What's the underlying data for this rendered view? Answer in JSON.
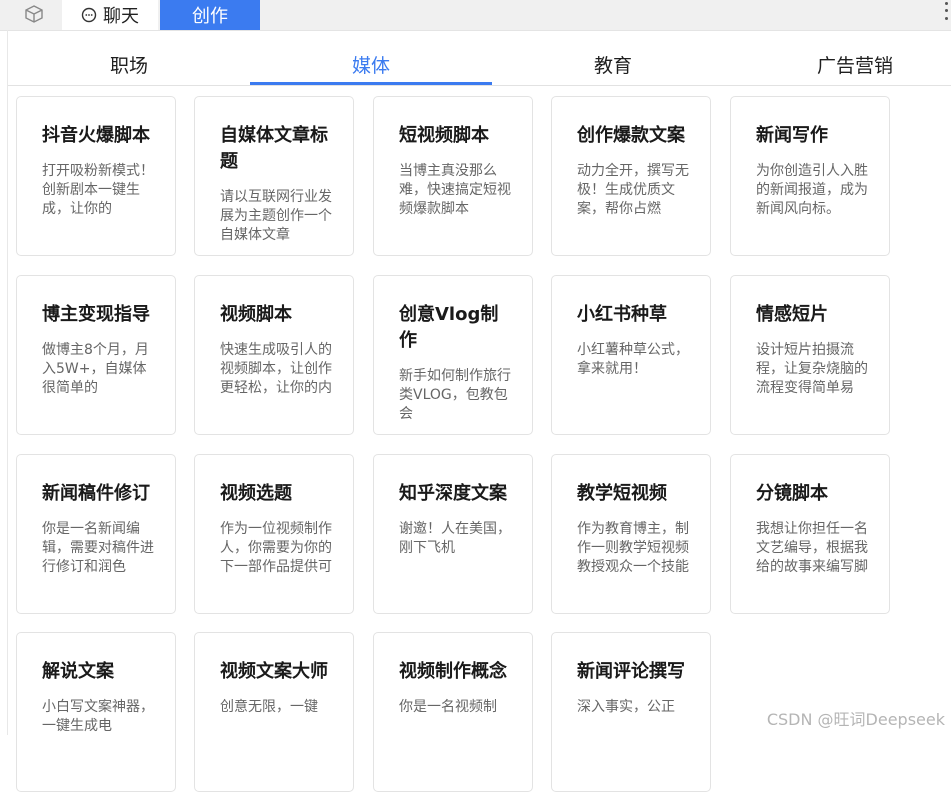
{
  "topbar": {
    "tabs": [
      {
        "label": "聊天",
        "icon": "chat-bubble-icon"
      },
      {
        "label": "创作"
      }
    ],
    "left_icon": "cube-icon",
    "right_icon": "more-vertical-icon",
    "accent_color": "#3b7bf0"
  },
  "categories": [
    "职场",
    "媒体",
    "教育",
    "广告营销"
  ],
  "active_category": "媒体",
  "cards": [
    {
      "title": "抖音火爆脚本",
      "desc": "打开吸粉新模式！创新剧本一键生成，让你的"
    },
    {
      "title": "自媒体文章标题",
      "desc": "请以互联网行业发展为主题创作一个自媒体文章"
    },
    {
      "title": "短视频脚本",
      "desc": "当博主真没那么难，快速搞定短视频爆款脚本"
    },
    {
      "title": "创作爆款文案",
      "desc": "动力全开，撰写无极！生成优质文案，帮你占燃"
    },
    {
      "title": "新闻写作",
      "desc": "为你创造引人入胜的新闻报道，成为新闻风向标。"
    },
    {
      "title": "博主变现指导",
      "desc": "做博主8个月，月入5W+，自媒体很简单的"
    },
    {
      "title": "视频脚本",
      "desc": "快速生成吸引人的视频脚本，让创作更轻松，让你的内容更引人"
    },
    {
      "title": "创意Vlog制作",
      "desc": "新手如何制作旅行类VLOG，包教包会"
    },
    {
      "title": "小红书种草",
      "desc": "小红薯种草公式，拿来就用！"
    },
    {
      "title": "情感短片",
      "desc": "设计短片拍摄流程，让复杂烧脑的流程变得简单易懂。"
    },
    {
      "title": "新闻稿件修订",
      "desc": "你是一名新闻编辑，需要对稿件进行修订和润色"
    },
    {
      "title": "视频选题",
      "desc": "作为一位视频制作人，你需要为你的下一部作品提供可能的选题"
    },
    {
      "title": "知乎深度文案",
      "desc": "谢邀！人在美国，刚下飞机"
    },
    {
      "title": "教学短视频",
      "desc": "作为教育博主，制作一则教学短视频教授观众一个技能或知识点"
    },
    {
      "title": "分镜脚本",
      "desc": "我想让你担任一名文艺编导，根据我给的故事来编写脚本，用标"
    },
    {
      "title": "解说文案",
      "desc": "小白写文案神器，一键生成电"
    },
    {
      "title": "视频文案大师",
      "desc": "创意无限，一键"
    },
    {
      "title": "视频制作概念",
      "desc": "你是一名视频制"
    },
    {
      "title": "新闻评论撰写",
      "desc": "深入事实，公正"
    }
  ],
  "watermark": "CSDN @旺词Deepseek"
}
